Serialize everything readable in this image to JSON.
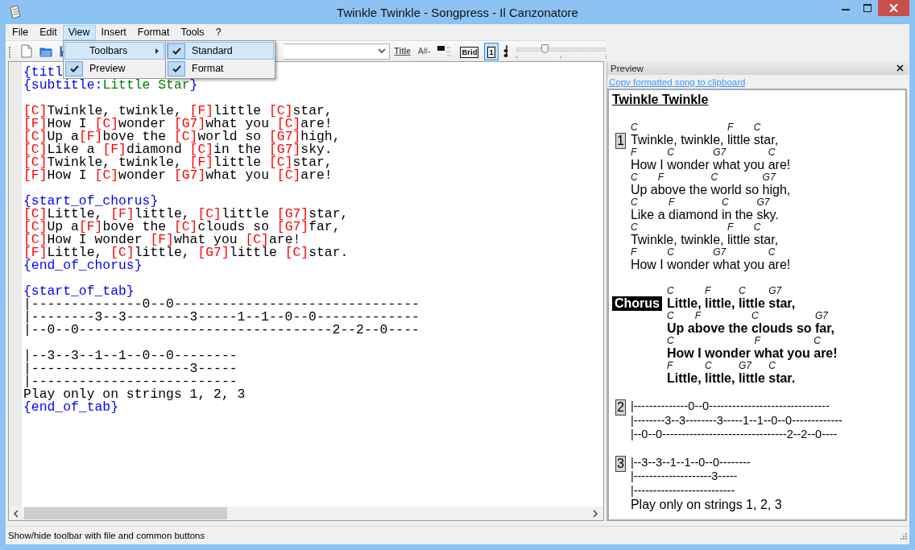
{
  "window": {
    "title": "Twinkle Twinkle - Songpress - Il Canzonatore"
  },
  "menu_bar": [
    {
      "label": "File",
      "selected": false
    },
    {
      "label": "Edit",
      "selected": false
    },
    {
      "label": "View",
      "selected": true
    },
    {
      "label": "Insert",
      "selected": false
    },
    {
      "label": "Format",
      "selected": false
    },
    {
      "label": "Tools",
      "selected": false
    },
    {
      "label": "?",
      "selected": false
    }
  ],
  "view_menu": [
    {
      "label": "Toolbars",
      "kind": "submenu",
      "checked": false,
      "selected": true
    },
    {
      "label": "Preview",
      "kind": "item",
      "checked": true,
      "selected": false
    }
  ],
  "toolbars_submenu": [
    {
      "label": "Standard",
      "checked": true,
      "selected": true
    },
    {
      "label": "Format",
      "checked": true,
      "selected": false
    }
  ],
  "toolbar": {
    "format_buttons": [
      {
        "kind": "title",
        "label": "Title",
        "selected": false
      },
      {
        "kind": "plain",
        "label": "A#-",
        "selected": false
      },
      {
        "kind": "boxed",
        "label": "Brid",
        "selected": false
      },
      {
        "kind": "boxed",
        "label": "1",
        "selected": true
      }
    ],
    "zoom_slider": {
      "level": 0.32
    }
  },
  "editor": {
    "lines": [
      {
        "kind": "code",
        "segments": [
          {
            "kind": "directive",
            "text": "{titl"
          }
        ]
      },
      {
        "kind": "code",
        "segments": [
          {
            "kind": "directive",
            "text": "{subtitle:"
          },
          {
            "kind": "value",
            "text": "Little Star"
          },
          {
            "kind": "directive",
            "text": "}"
          }
        ]
      },
      {
        "kind": "blank"
      },
      {
        "kind": "code",
        "segments": [
          {
            "kind": "chord",
            "text": "[C]"
          },
          {
            "kind": "text",
            "text": "Twinkle, twinkle, "
          },
          {
            "kind": "chord",
            "text": "[F]"
          },
          {
            "kind": "text",
            "text": "little "
          },
          {
            "kind": "chord",
            "text": "[C]"
          },
          {
            "kind": "text",
            "text": "star,"
          }
        ]
      },
      {
        "kind": "code",
        "segments": [
          {
            "kind": "chord",
            "text": "[F]"
          },
          {
            "kind": "text",
            "text": "How I "
          },
          {
            "kind": "chord",
            "text": "[C]"
          },
          {
            "kind": "text",
            "text": "wonder "
          },
          {
            "kind": "chord",
            "text": "[G7]"
          },
          {
            "kind": "text",
            "text": "what you "
          },
          {
            "kind": "chord",
            "text": "[C]"
          },
          {
            "kind": "text",
            "text": "are!"
          }
        ]
      },
      {
        "kind": "code",
        "segments": [
          {
            "kind": "chord",
            "text": "[C]"
          },
          {
            "kind": "text",
            "text": "Up a"
          },
          {
            "kind": "chord",
            "text": "[F]"
          },
          {
            "kind": "text",
            "text": "bove the "
          },
          {
            "kind": "chord",
            "text": "[C]"
          },
          {
            "kind": "text",
            "text": "world so "
          },
          {
            "kind": "chord",
            "text": "[G7]"
          },
          {
            "kind": "text",
            "text": "high,"
          }
        ]
      },
      {
        "kind": "code",
        "segments": [
          {
            "kind": "chord",
            "text": "[C]"
          },
          {
            "kind": "text",
            "text": "Like a "
          },
          {
            "kind": "chord",
            "text": "[F]"
          },
          {
            "kind": "text",
            "text": "diamond "
          },
          {
            "kind": "chord",
            "text": "[C]"
          },
          {
            "kind": "text",
            "text": "in the "
          },
          {
            "kind": "chord",
            "text": "[G7]"
          },
          {
            "kind": "text",
            "text": "sky."
          }
        ]
      },
      {
        "kind": "code",
        "segments": [
          {
            "kind": "chord",
            "text": "[C]"
          },
          {
            "kind": "text",
            "text": "Twinkle, twinkle, "
          },
          {
            "kind": "chord",
            "text": "[F]"
          },
          {
            "kind": "text",
            "text": "little "
          },
          {
            "kind": "chord",
            "text": "[C]"
          },
          {
            "kind": "text",
            "text": "star,"
          }
        ]
      },
      {
        "kind": "code",
        "segments": [
          {
            "kind": "chord",
            "text": "[F]"
          },
          {
            "kind": "text",
            "text": "How I "
          },
          {
            "kind": "chord",
            "text": "[C]"
          },
          {
            "kind": "text",
            "text": "wonder "
          },
          {
            "kind": "chord",
            "text": "[G7]"
          },
          {
            "kind": "text",
            "text": "what you "
          },
          {
            "kind": "chord",
            "text": "[C]"
          },
          {
            "kind": "text",
            "text": "are!"
          }
        ]
      },
      {
        "kind": "blank"
      },
      {
        "kind": "code",
        "segments": [
          {
            "kind": "directive",
            "text": "{start_of_chorus}"
          }
        ]
      },
      {
        "kind": "code",
        "segments": [
          {
            "kind": "chord",
            "text": "[C]"
          },
          {
            "kind": "text",
            "text": "Little, "
          },
          {
            "kind": "chord",
            "text": "[F]"
          },
          {
            "kind": "text",
            "text": "little, "
          },
          {
            "kind": "chord",
            "text": "[C]"
          },
          {
            "kind": "text",
            "text": "little "
          },
          {
            "kind": "chord",
            "text": "[G7]"
          },
          {
            "kind": "text",
            "text": "star,"
          }
        ]
      },
      {
        "kind": "code",
        "segments": [
          {
            "kind": "chord",
            "text": "[C]"
          },
          {
            "kind": "text",
            "text": "Up a"
          },
          {
            "kind": "chord",
            "text": "[F]"
          },
          {
            "kind": "text",
            "text": "bove the "
          },
          {
            "kind": "chord",
            "text": "[C]"
          },
          {
            "kind": "text",
            "text": "clouds so "
          },
          {
            "kind": "chord",
            "text": "[G7]"
          },
          {
            "kind": "text",
            "text": "far,"
          }
        ]
      },
      {
        "kind": "code",
        "segments": [
          {
            "kind": "chord",
            "text": "[C]"
          },
          {
            "kind": "text",
            "text": "How I wonder "
          },
          {
            "kind": "chord",
            "text": "[F]"
          },
          {
            "kind": "text",
            "text": "what you "
          },
          {
            "kind": "chord",
            "text": "[C]"
          },
          {
            "kind": "text",
            "text": "are!"
          }
        ]
      },
      {
        "kind": "code",
        "segments": [
          {
            "kind": "chord",
            "text": "[F]"
          },
          {
            "kind": "text",
            "text": "Little, "
          },
          {
            "kind": "chord",
            "text": "[C]"
          },
          {
            "kind": "text",
            "text": "little, "
          },
          {
            "kind": "chord",
            "text": "[G7]"
          },
          {
            "kind": "text",
            "text": "little "
          },
          {
            "kind": "chord",
            "text": "[C]"
          },
          {
            "kind": "text",
            "text": "star."
          }
        ]
      },
      {
        "kind": "code",
        "segments": [
          {
            "kind": "directive",
            "text": "{end_of_chorus}"
          }
        ]
      },
      {
        "kind": "blank"
      },
      {
        "kind": "code",
        "segments": [
          {
            "kind": "directive",
            "text": "{start_of_tab}"
          }
        ]
      },
      {
        "kind": "code",
        "segments": [
          {
            "kind": "text",
            "text": "|--------------0--0-------------------------------"
          }
        ]
      },
      {
        "kind": "code",
        "segments": [
          {
            "kind": "text",
            "text": "|--------3--3--------3-----1--1--0--0-------------"
          }
        ]
      },
      {
        "kind": "code",
        "segments": [
          {
            "kind": "text",
            "text": "|--0--0--------------------------------2--2--0----"
          }
        ]
      },
      {
        "kind": "blank"
      },
      {
        "kind": "code",
        "segments": [
          {
            "kind": "text",
            "text": "|--3--3--1--1--0--0--------"
          }
        ]
      },
      {
        "kind": "code",
        "segments": [
          {
            "kind": "text",
            "text": "|--------------------3-----"
          }
        ]
      },
      {
        "kind": "code",
        "segments": [
          {
            "kind": "text",
            "text": "|--------------------------"
          }
        ]
      },
      {
        "kind": "code",
        "segments": [
          {
            "kind": "text",
            "text": "Play only on strings 1, 2, 3"
          }
        ]
      },
      {
        "kind": "code",
        "segments": [
          {
            "kind": "directive",
            "text": "{end_of_tab}"
          }
        ]
      }
    ]
  },
  "preview": {
    "title": "Preview",
    "link": "Copy formatted song to clipboard",
    "song_title": "Twinkle Twinkle",
    "blocks": [
      {
        "kind": "verse",
        "badge": "1",
        "lines": [
          {
            "kind": "lyric",
            "chunks": [
              {
                "chord": "C",
                "text": "Twinkle, twinkle, "
              },
              {
                "chord": "F",
                "text": "little "
              },
              {
                "chord": "C",
                "text": "star,"
              }
            ]
          },
          {
            "kind": "lyric",
            "chunks": [
              {
                "chord": "F",
                "text": "How I "
              },
              {
                "chord": "C",
                "text": "wonder "
              },
              {
                "chord": "G7",
                "text": "what you "
              },
              {
                "chord": "C",
                "text": "are!"
              }
            ]
          },
          {
            "kind": "lyric",
            "chunks": [
              {
                "chord": "C",
                "text": "Up a"
              },
              {
                "chord": "F",
                "text": "bove the "
              },
              {
                "chord": "C",
                "text": "world so "
              },
              {
                "chord": "G7",
                "text": "high,"
              }
            ]
          },
          {
            "kind": "lyric",
            "chunks": [
              {
                "chord": "C",
                "text": "Like a "
              },
              {
                "chord": "F",
                "text": "diamond "
              },
              {
                "chord": "C",
                "text": "in the "
              },
              {
                "chord": "G7",
                "text": "sky."
              }
            ]
          },
          {
            "kind": "lyric",
            "chunks": [
              {
                "chord": "C",
                "text": "Twinkle, twinkle, "
              },
              {
                "chord": "F",
                "text": "little "
              },
              {
                "chord": "C",
                "text": "star,"
              }
            ]
          },
          {
            "kind": "lyric",
            "chunks": [
              {
                "chord": "F",
                "text": "How I "
              },
              {
                "chord": "C",
                "text": "wonder "
              },
              {
                "chord": "G7",
                "text": "what you "
              },
              {
                "chord": "C",
                "text": "are!"
              }
            ]
          }
        ]
      },
      {
        "kind": "chorus",
        "badge": "Chorus",
        "lines": [
          {
            "kind": "lyric",
            "chunks": [
              {
                "chord": "C",
                "text": "Little, "
              },
              {
                "chord": "F",
                "text": "little, "
              },
              {
                "chord": "C",
                "text": "little "
              },
              {
                "chord": "G7",
                "text": "star,"
              }
            ]
          },
          {
            "kind": "lyric",
            "chunks": [
              {
                "chord": "C",
                "text": "Up a"
              },
              {
                "chord": "F",
                "text": "bove the "
              },
              {
                "chord": "C",
                "text": "clouds so "
              },
              {
                "chord": "G7",
                "text": "far,"
              }
            ]
          },
          {
            "kind": "lyric",
            "chunks": [
              {
                "chord": "C",
                "text": "How I wonder "
              },
              {
                "chord": "F",
                "text": "what you "
              },
              {
                "chord": "C",
                "text": "are!"
              }
            ]
          },
          {
            "kind": "lyric",
            "chunks": [
              {
                "chord": "F",
                "text": "Little, "
              },
              {
                "chord": "C",
                "text": "little, "
              },
              {
                "chord": "G7",
                "text": "little "
              },
              {
                "chord": "C",
                "text": "star."
              }
            ]
          }
        ]
      },
      {
        "kind": "tab",
        "badge": "2",
        "lines": [
          {
            "kind": "tab",
            "text": "|--------------0--0-------------------------------"
          },
          {
            "kind": "tab",
            "text": "|--------3--3--------3-----1--1--0--0-------------"
          },
          {
            "kind": "tab",
            "text": "|--0--0--------------------------------2--2--0----"
          }
        ]
      },
      {
        "kind": "tab",
        "badge": "3",
        "lines": [
          {
            "kind": "tab",
            "text": "|--3--3--1--1--0--0--------"
          },
          {
            "kind": "tab",
            "text": "|--------------------3-----"
          },
          {
            "kind": "tab",
            "text": "|--------------------------"
          },
          {
            "kind": "text",
            "text": "Play only on strings 1, 2, 3"
          }
        ]
      }
    ]
  },
  "status_bar": "Show/hide toolbar with file and common buttons"
}
